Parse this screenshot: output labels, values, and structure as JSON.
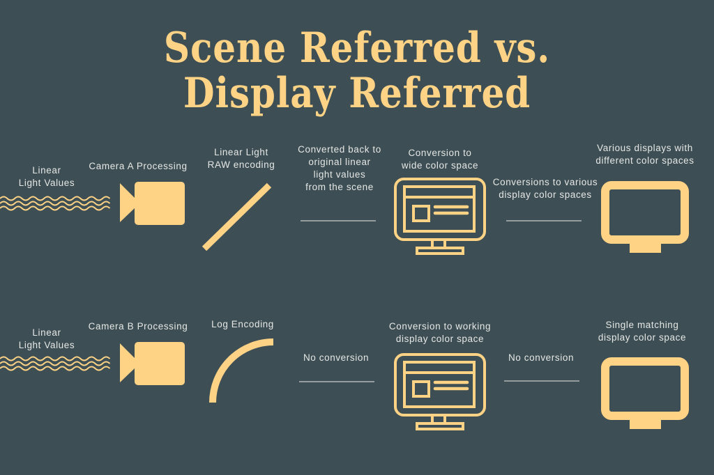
{
  "title": {
    "line1": "Scene Referred vs.",
    "line2": "Display Referred"
  },
  "colors": {
    "background": "#3d4e54",
    "accent": "#fed386",
    "text": "#e6e8e6",
    "rule": "#c8cccb"
  },
  "rows": [
    {
      "name": "scene-referred",
      "labels": {
        "source_line1": "Linear",
        "source_line2": "Light Values",
        "camera": "Camera A Processing",
        "encoding_line1": "Linear Light",
        "encoding_line2": "RAW encoding",
        "conversion1_line1": "Converted back to",
        "conversion1_line2": "original linear",
        "conversion1_line3": "light values",
        "conversion1_line4": "from the scene",
        "working_line1": "Conversion to",
        "working_line2": "wide color space",
        "conversion2_line1": "Conversions to various",
        "conversion2_line2": "display color spaces",
        "display_line1": "Various displays with",
        "display_line2": "different color spaces"
      },
      "icons": [
        "wave-icon",
        "video-camera-icon",
        "linear-curve-icon",
        "monitor-icon",
        "display-icon"
      ]
    },
    {
      "name": "display-referred",
      "labels": {
        "source_line1": "Linear",
        "source_line2": "Light Values",
        "camera": "Camera B Processing",
        "encoding": "Log Encoding",
        "conversion1": "No conversion",
        "working_line1": "Conversion to working",
        "working_line2": "display color space",
        "conversion2": "No conversion",
        "display_line1": "Single matching",
        "display_line2": "display color space"
      },
      "icons": [
        "wave-icon",
        "video-camera-icon",
        "log-curve-icon",
        "monitor-icon",
        "display-icon"
      ]
    }
  ]
}
